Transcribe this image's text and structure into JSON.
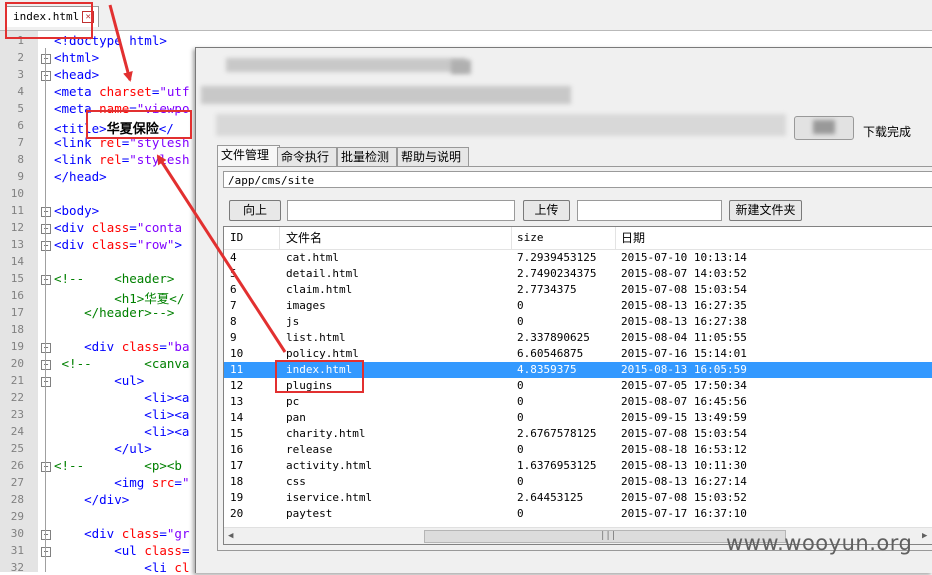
{
  "editor": {
    "tab_label": "index.html",
    "lines": [
      {
        "n": "1",
        "html": "&lt;!doctype html&gt;"
      },
      {
        "n": "2",
        "html": "&lt;html&gt;"
      },
      {
        "n": "3",
        "html": "&lt;head&gt;"
      },
      {
        "n": "4",
        "html": "&lt;meta <span class='attr'>charset</span>=<span class='str'>\"utf</span>"
      },
      {
        "n": "5",
        "html": "&lt;meta <span class='attr'>name</span>=<span class='str'>\"viewpo</span>"
      },
      {
        "n": "6",
        "html": "&lt;title&gt;<span class='txt'>华夏保险</span>&lt;/"
      },
      {
        "n": "7",
        "html": "&lt;link <span class='attr'>rel</span>=<span class='str'>\"stylesh</span>"
      },
      {
        "n": "8",
        "html": "&lt;link <span class='attr'>rel</span>=<span class='str'>\"stylesh</span>"
      },
      {
        "n": "9",
        "html": "&lt;/head&gt;"
      },
      {
        "n": "10",
        "html": ""
      },
      {
        "n": "11",
        "html": "&lt;body&gt;"
      },
      {
        "n": "12",
        "html": "&lt;div <span class='attr'>class</span>=<span class='str'>\"conta</span>"
      },
      {
        "n": "13",
        "html": "&lt;div <span class='attr'>class</span>=<span class='str'>\"row\"</span>&gt;"
      },
      {
        "n": "14",
        "html": ""
      },
      {
        "n": "15",
        "html": "<span class='cmt'>&lt;!--    &lt;header&gt;</span>"
      },
      {
        "n": "16",
        "html": "<span class='cmt'>        &lt;h1&gt;华夏&lt;/</span>"
      },
      {
        "n": "17",
        "html": "<span class='cmt'>    &lt;/header&gt;--&gt;</span>"
      },
      {
        "n": "18",
        "html": ""
      },
      {
        "n": "19",
        "html": "    &lt;div <span class='attr'>class</span>=<span class='str'>\"ba</span>"
      },
      {
        "n": "20",
        "html": "<span class='cmt'> &lt;!--       &lt;canva</span>"
      },
      {
        "n": "21",
        "html": "        &lt;ul&gt;"
      },
      {
        "n": "22",
        "html": "            &lt;li&gt;&lt;a"
      },
      {
        "n": "23",
        "html": "            &lt;li&gt;&lt;a"
      },
      {
        "n": "24",
        "html": "            &lt;li&gt;&lt;a"
      },
      {
        "n": "25",
        "html": "        &lt;/ul&gt;"
      },
      {
        "n": "26",
        "html": "<span class='cmt'>&lt;!--        &lt;p&gt;&lt;b</span>"
      },
      {
        "n": "27",
        "html": "        &lt;img <span class='attr'>src</span>=<span class='str'>\"</span>"
      },
      {
        "n": "28",
        "html": "    &lt;/div&gt;"
      },
      {
        "n": "29",
        "html": ""
      },
      {
        "n": "30",
        "html": "    &lt;div <span class='attr'>class</span>=<span class='str'>\"gr</span>"
      },
      {
        "n": "31",
        "html": "        &lt;ul <span class='attr'>class</span>=<span class='str'></span>"
      },
      {
        "n": "32",
        "html": "            &lt;li <span class='attr'>cl</span>"
      }
    ]
  },
  "tool": {
    "download_status": "下载完成",
    "tabs": [
      "文件管理",
      "命令执行",
      "批量检测",
      "帮助与说明"
    ],
    "path": "/app/cms/site",
    "up_button": "向上",
    "upload_button": "上传",
    "new_folder_button": "新建文件夹",
    "columns": {
      "id": "ID",
      "name": "文件名",
      "size": "size",
      "date": "日期"
    },
    "files": [
      {
        "id": "4",
        "name": "cat.html",
        "size": "7.2939453125",
        "date": "2015-07-10 10:13:14"
      },
      {
        "id": "5",
        "name": "detail.html",
        "size": "2.7490234375",
        "date": "2015-08-07 14:03:52"
      },
      {
        "id": "6",
        "name": "claim.html",
        "size": "2.7734375",
        "date": "2015-07-08 15:03:54"
      },
      {
        "id": "7",
        "name": "images",
        "size": "0",
        "date": "2015-08-13 16:27:35"
      },
      {
        "id": "8",
        "name": "js",
        "size": "0",
        "date": "2015-08-13 16:27:38"
      },
      {
        "id": "9",
        "name": "list.html",
        "size": "2.337890625",
        "date": "2015-08-04 11:05:55"
      },
      {
        "id": "10",
        "name": "policy.html",
        "size": "6.60546875",
        "date": "2015-07-16 15:14:01"
      },
      {
        "id": "11",
        "name": "index.html",
        "size": "4.8359375",
        "date": "2015-08-13 16:05:59",
        "selected": true
      },
      {
        "id": "12",
        "name": "plugins",
        "size": "0",
        "date": "2015-07-05 17:50:34"
      },
      {
        "id": "13",
        "name": "pc",
        "size": "0",
        "date": "2015-08-07 16:45:56"
      },
      {
        "id": "14",
        "name": "pan",
        "size": "0",
        "date": "2015-09-15 13:49:59"
      },
      {
        "id": "15",
        "name": "charity.html",
        "size": "2.6767578125",
        "date": "2015-07-08 15:03:54"
      },
      {
        "id": "16",
        "name": "release",
        "size": "0",
        "date": "2015-08-18 16:53:12"
      },
      {
        "id": "17",
        "name": "activity.html",
        "size": "1.6376953125",
        "date": "2015-08-13 10:11:30"
      },
      {
        "id": "18",
        "name": "css",
        "size": "0",
        "date": "2015-08-13 16:27:14"
      },
      {
        "id": "19",
        "name": "iservice.html",
        "size": "2.64453125",
        "date": "2015-07-08 15:03:52"
      },
      {
        "id": "20",
        "name": "paytest",
        "size": "0",
        "date": "2015-07-17 16:37:10"
      }
    ]
  },
  "watermark": "www.wooyun.org",
  "colors": {
    "annotation_red": "#e23030",
    "selection_blue": "#3399ff"
  }
}
